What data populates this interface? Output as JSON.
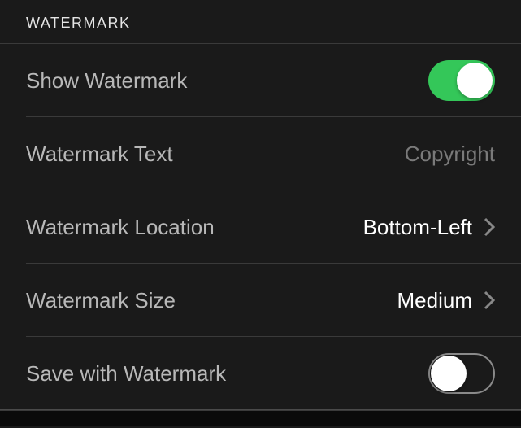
{
  "section": {
    "header": "WATERMARK"
  },
  "rows": {
    "show_watermark": {
      "label": "Show Watermark",
      "toggle_state": "on"
    },
    "watermark_text": {
      "label": "Watermark Text",
      "placeholder": "Copyright"
    },
    "watermark_location": {
      "label": "Watermark Location",
      "value": "Bottom-Left"
    },
    "watermark_size": {
      "label": "Watermark Size",
      "value": "Medium"
    },
    "save_with_watermark": {
      "label": "Save with Watermark",
      "toggle_state": "off"
    }
  },
  "colors": {
    "toggle_on": "#34c759",
    "background": "#1a1a1a"
  }
}
